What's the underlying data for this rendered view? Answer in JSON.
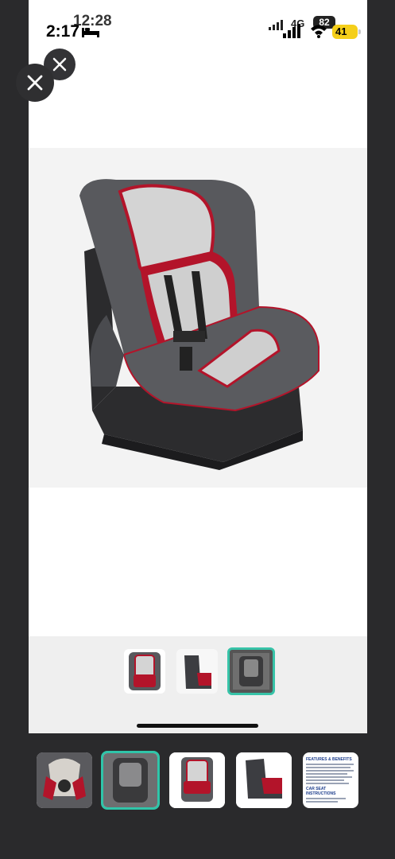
{
  "inner_status": {
    "time": "12:28",
    "network": "4G",
    "battery": "82"
  },
  "outer_status": {
    "time": "2:17",
    "battery": "41"
  },
  "icons": {
    "close": "close-icon",
    "bed": "bed-icon",
    "signal": "signal-icon",
    "wifi": "wifi-icon",
    "battery": "battery-icon"
  },
  "colors": {
    "seat_grey": "#55565a",
    "seat_red": "#b3142a",
    "seat_light": "#d6d6d6",
    "selected_border": "#37c3a8"
  },
  "doc_thumb": {
    "heading1": "FEATURES & BENEFITS",
    "heading2": "CAR SEAT INSTRUCTIONS"
  }
}
